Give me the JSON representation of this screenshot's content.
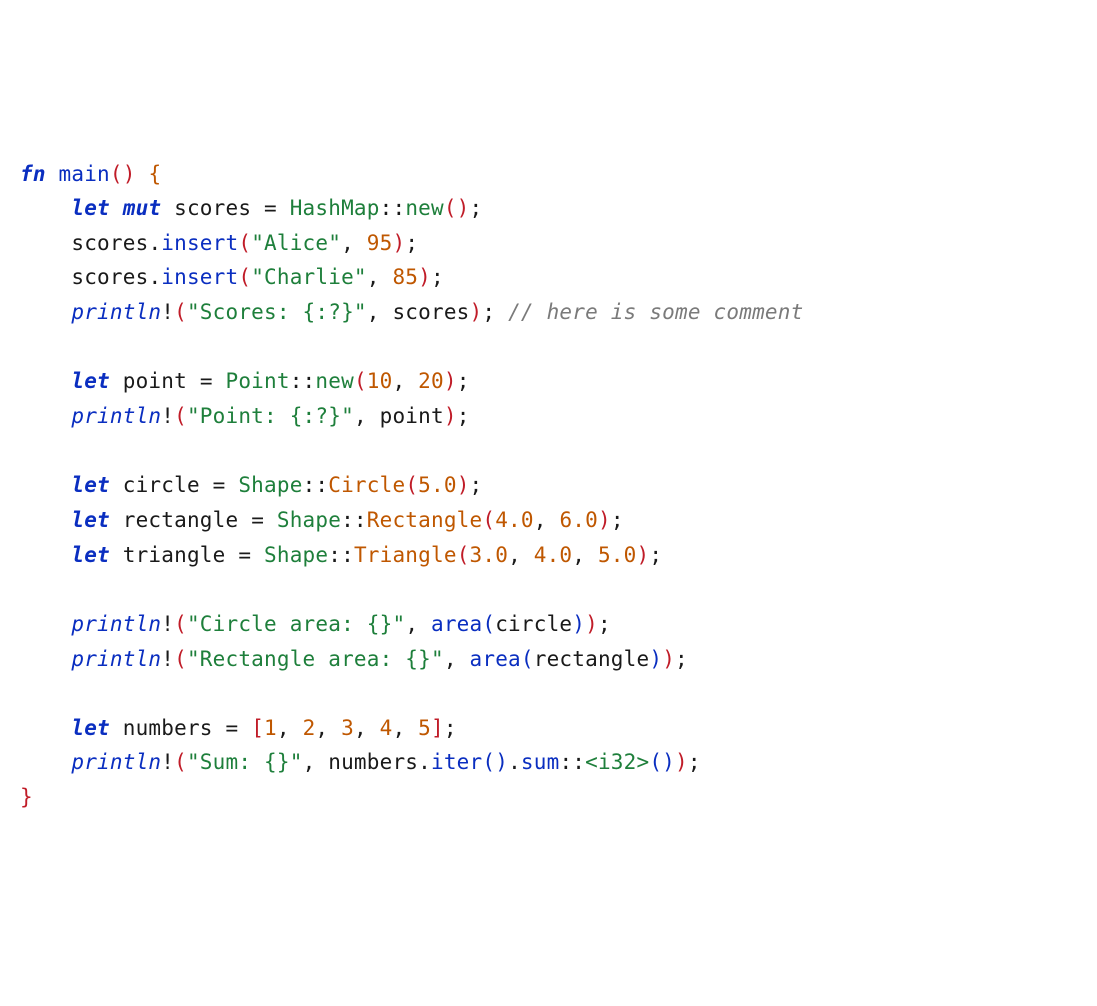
{
  "code": {
    "fn": "fn",
    "main": "main",
    "let": "let",
    "mut": "mut",
    "scores": "scores",
    "hashmap": "HashMap",
    "new": "new",
    "insert": "insert",
    "alice": "\"Alice\"",
    "alice_score": "95",
    "charlie": "\"Charlie\"",
    "charlie_score": "85",
    "println": "println",
    "scores_fmt": "\"Scores: {:?}\"",
    "comment": "// here is some comment",
    "point": "point",
    "point_ty": "Point",
    "point_x": "10",
    "point_y": "20",
    "point_fmt": "\"Point: {:?}\"",
    "circle": "circle",
    "shape": "Shape",
    "circle_var": "Circle",
    "circle_r": "5.0",
    "rectangle": "rectangle",
    "rect_var": "Rectangle",
    "rect_w": "4.0",
    "rect_h": "6.0",
    "triangle": "triangle",
    "tri_var": "Triangle",
    "tri_a": "3.0",
    "tri_b": "4.0",
    "tri_c": "5.0",
    "circle_fmt": "\"Circle area: {}\"",
    "rect_fmt": "\"Rectangle area: {}\"",
    "area": "area",
    "numbers": "numbers",
    "n1": "1",
    "n2": "2",
    "n3": "3",
    "n4": "4",
    "n5": "5",
    "sum_fmt": "\"Sum: {}\"",
    "iter": "iter",
    "sum": "sum",
    "i32": "i32"
  }
}
